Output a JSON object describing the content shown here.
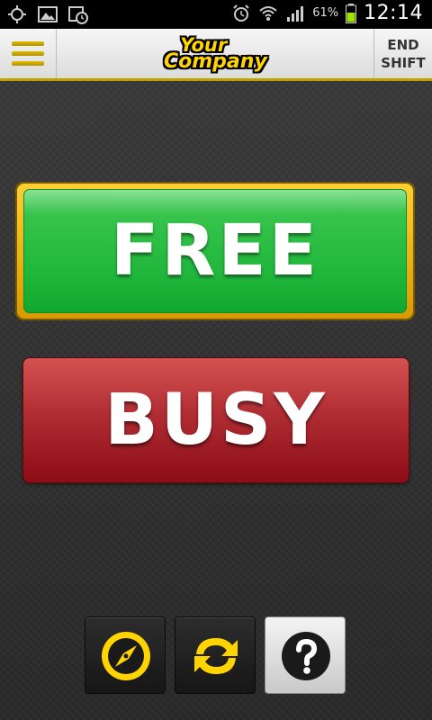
{
  "status_bar": {
    "battery_percent": "61%",
    "time": "12:14",
    "icons": [
      "gps-icon",
      "gallery-icon",
      "calendar-clock-icon",
      "alarm-icon",
      "wifi-icon",
      "signal-icon",
      "battery-icon"
    ]
  },
  "header": {
    "menu_icon": "hamburger-menu-icon",
    "logo_line1": "Your",
    "logo_line2": "Company",
    "end_shift_line1": "END",
    "end_shift_line2": "SHIFT"
  },
  "main": {
    "free_label": "FREE",
    "busy_label": "BUSY"
  },
  "toolbar": {
    "buttons": [
      {
        "icon": "compass-icon"
      },
      {
        "icon": "refresh-icon"
      },
      {
        "icon": "help-icon"
      }
    ]
  },
  "colors": {
    "accent": "#ffd400",
    "free": "#1fb63b",
    "busy": "#a0141f"
  }
}
